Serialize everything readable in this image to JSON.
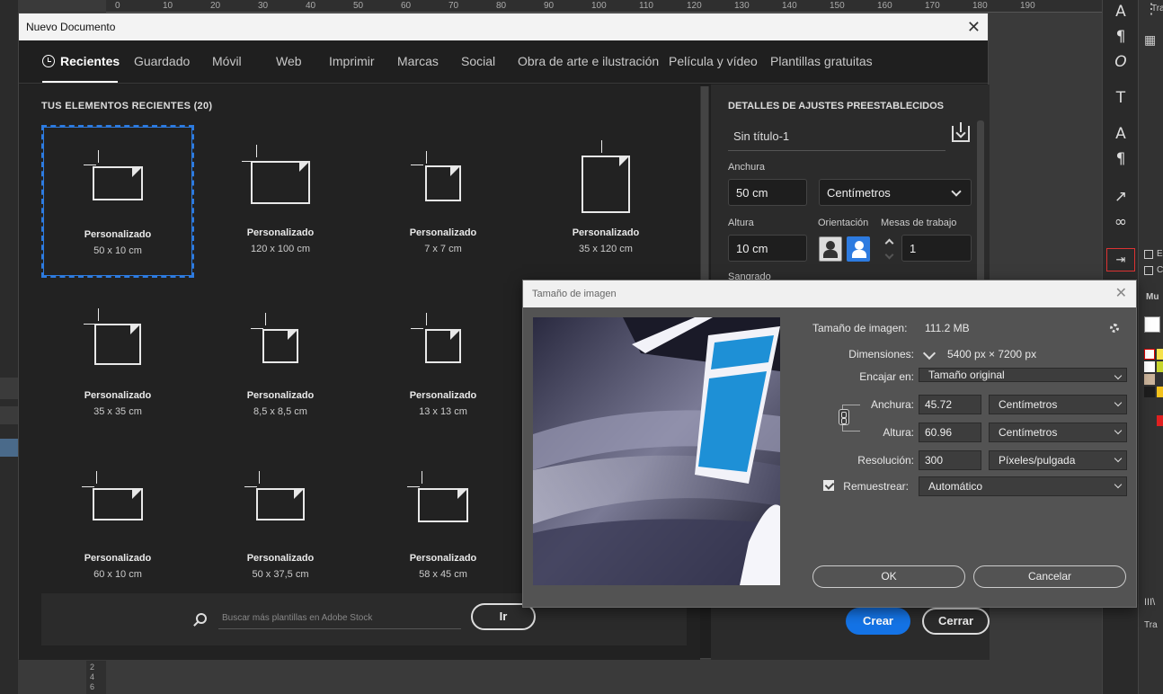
{
  "ruler_top": [
    "0",
    "10",
    "20",
    "30",
    "40",
    "50",
    "60",
    "70",
    "80",
    "90",
    "100",
    "110",
    "120",
    "130",
    "140",
    "150",
    "160",
    "170",
    "180",
    "190"
  ],
  "ruler_left": [
    "2",
    "4",
    "6"
  ],
  "toolbar_icons": [
    "type-icon",
    "paragraph-icon",
    "glyph-icon",
    "type-on-path-icon",
    "text-style-icon",
    "para-style-icon",
    "export-icon",
    "link-icon",
    "frame-icon"
  ],
  "right_panel": {
    "tab1": "Tra",
    "tab2": "Mu",
    "tab3": "Tra",
    "e_label": "E",
    "c_label": "C"
  },
  "new_doc": {
    "title": "Nuevo Documento",
    "tabs": [
      "Recientes",
      "Guardado",
      "Móvil",
      "Web",
      "Imprimir",
      "Marcas",
      "Social",
      "Obra de arte e ilustración",
      "Película y vídeo",
      "Plantillas gratuitas"
    ],
    "recent_title": "TUS ELEMENTOS RECIENTES",
    "recent_count": "(20)",
    "items": [
      {
        "name": "Personalizado",
        "size": "50 x 10 cm"
      },
      {
        "name": "Personalizado",
        "size": "120 x 100 cm"
      },
      {
        "name": "Personalizado",
        "size": "7 x 7 cm"
      },
      {
        "name": "Personalizado",
        "size": "35 x 120 cm"
      },
      {
        "name": "Personalizado",
        "size": "35 x 35 cm"
      },
      {
        "name": "Personalizado",
        "size": "8,5 x 8,5 cm"
      },
      {
        "name": "Personalizado",
        "size": "13 x 13 cm"
      },
      {
        "name": "Personalizado",
        "size": "60 x 10 cm"
      },
      {
        "name": "Personalizado",
        "size": "50 x 37,5 cm"
      },
      {
        "name": "Personalizado",
        "size": "58 x 45 cm"
      }
    ],
    "search_placeholder": "Buscar más plantillas en Adobe Stock",
    "go_label": "Ir",
    "details": {
      "title": "DETALLES DE AJUSTES PREESTABLECIDOS",
      "doc_name": "Sin título-1",
      "width_label": "Anchura",
      "width_value": "50 cm",
      "unit_value": "Centímetros",
      "height_label": "Altura",
      "height_value": "10 cm",
      "orientation_label": "Orientación",
      "artboards_label": "Mesas de trabajo",
      "artboards_value": "1",
      "bleed_label": "Sangrado"
    },
    "create_label": "Crear",
    "close_label": "Cerrar"
  },
  "image_size": {
    "title": "Tamaño de imagen",
    "size_label": "Tamaño de imagen:",
    "size_value": "111.2 MB",
    "dims_label": "Dimensiones:",
    "dims_value": "5400 px × 7200 px",
    "fit_label": "Encajar en:",
    "fit_value": "Tamaño original",
    "width_label": "Anchura:",
    "width_value": "45.72",
    "width_unit": "Centímetros",
    "height_label": "Altura:",
    "height_value": "60.96",
    "height_unit": "Centímetros",
    "res_label": "Resolución:",
    "res_value": "300",
    "res_unit": "Píxeles/pulgada",
    "resample_label": "Remuestrear:",
    "resample_value": "Automático",
    "ok_label": "OK",
    "cancel_label": "Cancelar"
  }
}
